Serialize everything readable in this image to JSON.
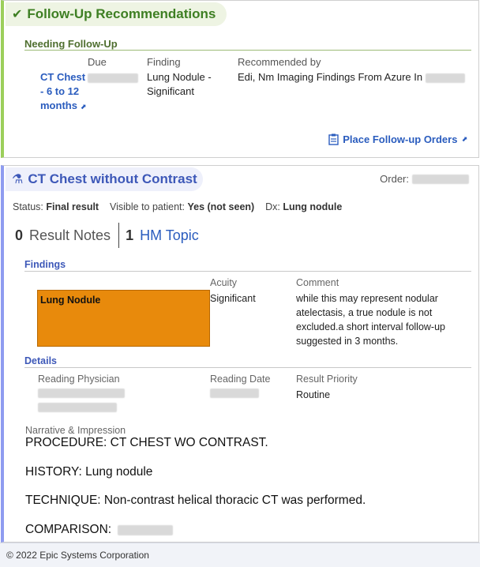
{
  "followup": {
    "title": "Follow-Up Recommendations",
    "section": "Needing Follow-Up",
    "columns": {
      "due": "Due",
      "finding": "Finding",
      "recommended_by": "Recommended by"
    },
    "item": {
      "link": "CT Chest - 6 to 12 months",
      "finding": "Lung Nodule - Significant",
      "recommended_by": "Edi, Nm Imaging Findings From Azure In"
    },
    "place_orders": "Place Follow-up Orders"
  },
  "result": {
    "title": "CT Chest without Contrast",
    "order_label": "Order:",
    "status_label": "Status:",
    "status_value": "Final result",
    "visible_label": "Visible to patient:",
    "visible_value": "Yes (not seen)",
    "dx_label": "Dx:",
    "dx_value": "Lung nodule",
    "tabs": [
      {
        "count": "0",
        "label": "Result Notes"
      },
      {
        "count": "1",
        "label": "HM Topic"
      }
    ],
    "findings": {
      "section": "Findings",
      "acuity_label": "Acuity",
      "comment_label": "Comment",
      "name": "Lung Nodule",
      "acuity": "Significant",
      "comment": "while this may represent nodular atelectasis, a true nodule is not excluded.a short interval follow-up suggested in 3 months."
    },
    "details": {
      "section": "Details",
      "physician_label": "Reading Physician",
      "date_label": "Reading Date",
      "priority_label": "Result Priority",
      "priority": "Routine"
    },
    "narrative_label": "Narrative & Impression",
    "narrative": [
      "PROCEDURE:  CT CHEST WO CONTRAST.",
      "HISTORY:  Lung nodule",
      "TECHNIQUE:  Non-contrast helical thoracic CT was performed.",
      "COMPARISON:"
    ]
  },
  "footer": "© 2022 Epic Systems Corporation",
  "colors": {
    "green_accent": "#9ccf5b",
    "blue_accent": "#8f9cf0",
    "finding_orange": "#e88a0c",
    "link": "#2a5cbe"
  }
}
